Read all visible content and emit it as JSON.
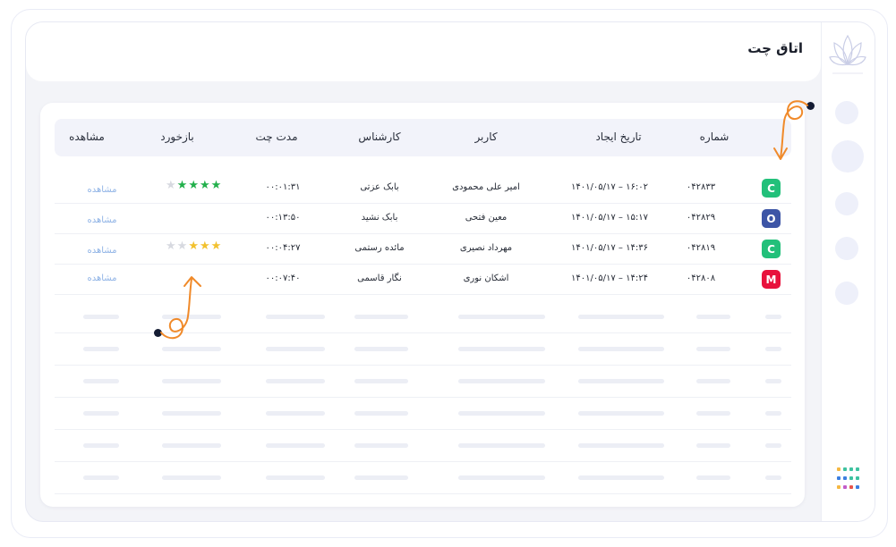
{
  "header": {
    "title": "اتاق چت"
  },
  "table": {
    "columns": {
      "number": "شماره",
      "created": "تاریخ ایجاد",
      "user": "کاربر",
      "agent": "کارشناس",
      "duration": "مدت چت",
      "feedback": "بازخورد",
      "view": "مشاهده"
    },
    "rows": [
      {
        "badge": "C",
        "badge_color": "#22c07a",
        "number": "۰۴۲۸۳۳",
        "created": "۱۴۰۱/۰۵/۱۷ – ۱۶:۰۲",
        "user": "امیر علی محمودی",
        "agent": "بابک عزتی",
        "duration": "۰۰:۰۱:۳۱",
        "rating": 4,
        "star_color": "#22b04b",
        "view": "مشاهده"
      },
      {
        "badge": "O",
        "badge_color": "#3d55a6",
        "number": "۰۴۲۸۲۹",
        "created": "۱۴۰۱/۰۵/۱۷ – ۱۵:۱۷",
        "user": "معین فتحی",
        "agent": "بابک نشید",
        "duration": "۰۰:۱۳:۵۰",
        "rating": 0,
        "star_color": "",
        "view": "مشاهده"
      },
      {
        "badge": "C",
        "badge_color": "#22c07a",
        "number": "۰۴۲۸۱۹",
        "created": "۱۴۰۱/۰۵/۱۷ – ۱۴:۳۶",
        "user": "مهرداد نصیری",
        "agent": "مائده رستمی",
        "duration": "۰۰:۰۴:۲۷",
        "rating": 3,
        "star_color": "#f2c12e",
        "view": "مشاهده"
      },
      {
        "badge": "M",
        "badge_color": "#e8123c",
        "number": "۰۴۲۸۰۸",
        "created": "۱۴۰۱/۰۵/۱۷ – ۱۴:۲۴",
        "user": "اشکان نوری",
        "agent": "نگار قاسمی",
        "duration": "۰۰:۰۷:۴۰",
        "rating": 0,
        "star_color": "",
        "view": "مشاهده"
      }
    ]
  },
  "icons": {
    "logo": "lotus-logo-icon",
    "apps": "apps-grid-icon"
  },
  "colors": {
    "view_link": "#8fb3e6",
    "arrow": "#f08a2a",
    "empty_star": "#d7d9e0"
  }
}
